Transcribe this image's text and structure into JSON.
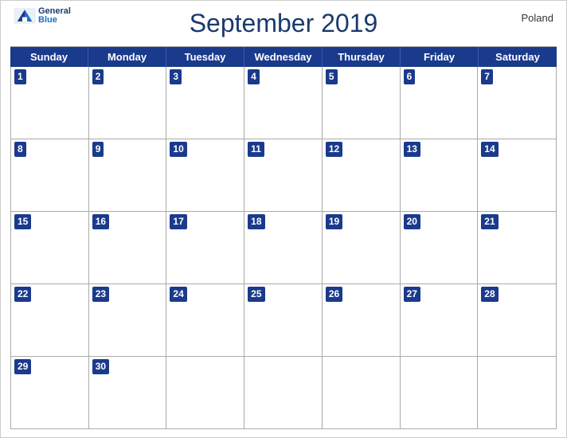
{
  "header": {
    "title": "September 2019",
    "country": "Poland",
    "logo": {
      "general": "General",
      "blue": "Blue"
    }
  },
  "days_of_week": [
    "Sunday",
    "Monday",
    "Tuesday",
    "Wednesday",
    "Thursday",
    "Friday",
    "Saturday"
  ],
  "weeks": [
    [
      {
        "date": 1,
        "empty": false
      },
      {
        "date": 2,
        "empty": false
      },
      {
        "date": 3,
        "empty": false
      },
      {
        "date": 4,
        "empty": false
      },
      {
        "date": 5,
        "empty": false
      },
      {
        "date": 6,
        "empty": false
      },
      {
        "date": 7,
        "empty": false
      }
    ],
    [
      {
        "date": 8,
        "empty": false
      },
      {
        "date": 9,
        "empty": false
      },
      {
        "date": 10,
        "empty": false
      },
      {
        "date": 11,
        "empty": false
      },
      {
        "date": 12,
        "empty": false
      },
      {
        "date": 13,
        "empty": false
      },
      {
        "date": 14,
        "empty": false
      }
    ],
    [
      {
        "date": 15,
        "empty": false
      },
      {
        "date": 16,
        "empty": false
      },
      {
        "date": 17,
        "empty": false
      },
      {
        "date": 18,
        "empty": false
      },
      {
        "date": 19,
        "empty": false
      },
      {
        "date": 20,
        "empty": false
      },
      {
        "date": 21,
        "empty": false
      }
    ],
    [
      {
        "date": 22,
        "empty": false
      },
      {
        "date": 23,
        "empty": false
      },
      {
        "date": 24,
        "empty": false
      },
      {
        "date": 25,
        "empty": false
      },
      {
        "date": 26,
        "empty": false
      },
      {
        "date": 27,
        "empty": false
      },
      {
        "date": 28,
        "empty": false
      }
    ],
    [
      {
        "date": 29,
        "empty": false
      },
      {
        "date": 30,
        "empty": false
      },
      {
        "date": null,
        "empty": true
      },
      {
        "date": null,
        "empty": true
      },
      {
        "date": null,
        "empty": true
      },
      {
        "date": null,
        "empty": true
      },
      {
        "date": null,
        "empty": true
      }
    ]
  ]
}
